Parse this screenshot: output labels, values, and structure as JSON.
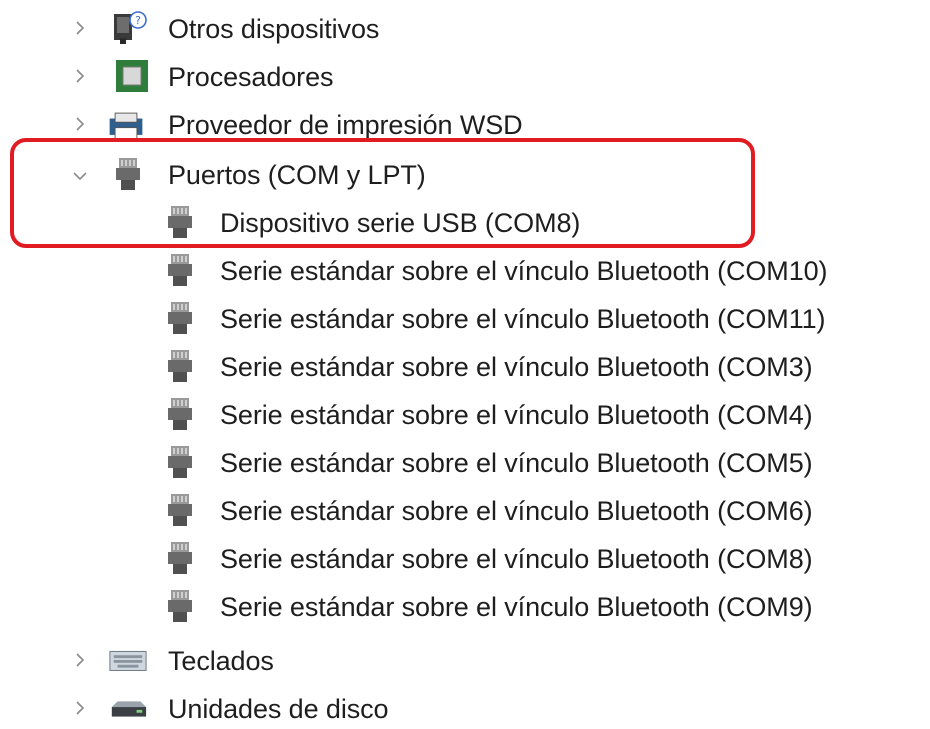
{
  "tree": {
    "categories": [
      {
        "label": "Otros dispositivos",
        "icon": "other-devices-icon",
        "expanded": false
      },
      {
        "label": "Procesadores",
        "icon": "processor-icon",
        "expanded": false
      },
      {
        "label": "Proveedor de impresión WSD",
        "icon": "printer-icon",
        "expanded": false
      },
      {
        "label": "Puertos (COM y LPT)",
        "icon": "port-icon",
        "expanded": true,
        "children": [
          {
            "label": "Dispositivo serie USB (COM8)",
            "icon": "port-icon"
          },
          {
            "label": "Serie estándar sobre el vínculo Bluetooth (COM10)",
            "icon": "port-icon"
          },
          {
            "label": "Serie estándar sobre el vínculo Bluetooth (COM11)",
            "icon": "port-icon"
          },
          {
            "label": "Serie estándar sobre el vínculo Bluetooth (COM3)",
            "icon": "port-icon"
          },
          {
            "label": "Serie estándar sobre el vínculo Bluetooth (COM4)",
            "icon": "port-icon"
          },
          {
            "label": "Serie estándar sobre el vínculo Bluetooth (COM5)",
            "icon": "port-icon"
          },
          {
            "label": "Serie estándar sobre el vínculo Bluetooth (COM6)",
            "icon": "port-icon"
          },
          {
            "label": "Serie estándar sobre el vínculo Bluetooth (COM8)",
            "icon": "port-icon"
          },
          {
            "label": "Serie estándar sobre el vínculo Bluetooth (COM9)",
            "icon": "port-icon"
          }
        ]
      },
      {
        "label": "Teclados",
        "icon": "keyboard-icon",
        "expanded": false
      },
      {
        "label": "Unidades de disco",
        "icon": "disk-drive-icon",
        "expanded": false
      }
    ]
  },
  "highlight_color": "#e11b22"
}
